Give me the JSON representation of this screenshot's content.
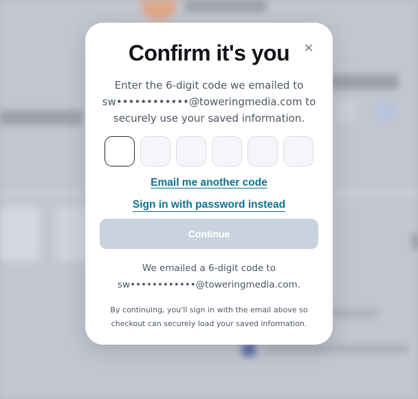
{
  "modal": {
    "title": "Confirm it's you",
    "close_glyph": "×",
    "description_lines": [
      "Enter the 6-digit code we emailed to",
      "sw••••••••••••@toweringmedia.com to",
      "securely use your saved information."
    ],
    "code_inputs": [
      "",
      "",
      "",
      "",
      "",
      ""
    ],
    "resend_link": "Email me another code",
    "password_link": "Sign in with password instead",
    "continue_label": "Continue",
    "sent_lines": [
      "We emailed a 6-digit code to",
      "sw••••••••••••@toweringmedia.com."
    ],
    "footnote_lines": [
      "By continuing, you'll sign in with the email above so",
      "checkout can securely load your saved information."
    ]
  },
  "colors": {
    "link": "#0f6f8f",
    "continue_disabled": "#c9d3df",
    "title": "#111318"
  },
  "icons": {
    "close": "close-icon"
  }
}
